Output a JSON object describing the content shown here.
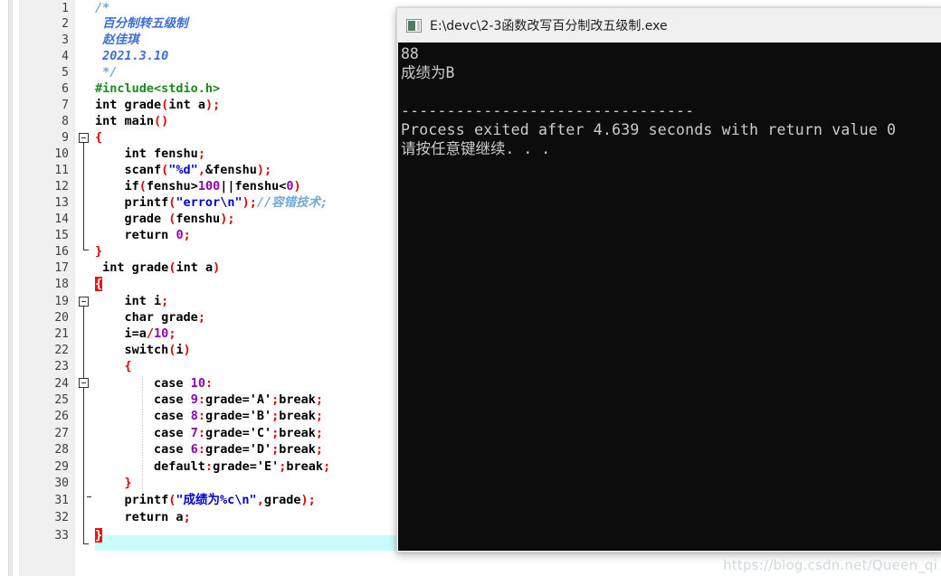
{
  "editor": {
    "name": "dev-cpp-editor",
    "gutter_bg": "#f0f0f0",
    "current_line": 33,
    "current_line_highlight": "#ccfbfb",
    "matching_brace_bg": "#ef1010",
    "line_numbers": [
      1,
      2,
      3,
      4,
      5,
      6,
      7,
      8,
      9,
      10,
      11,
      12,
      13,
      14,
      15,
      16,
      17,
      18,
      19,
      20,
      21,
      22,
      23,
      24,
      25,
      26,
      27,
      28,
      29,
      30,
      31,
      32,
      33
    ],
    "lines": [
      {
        "n": 1,
        "text": "/*"
      },
      {
        "n": 2,
        "text": " 百分制转五级制"
      },
      {
        "n": 3,
        "text": " 赵佳琪"
      },
      {
        "n": 4,
        "text": " 2021.3.10"
      },
      {
        "n": 5,
        "text": " */"
      },
      {
        "n": 6,
        "text": "#include<stdio.h>"
      },
      {
        "n": 7,
        "text": "int grade(int a);"
      },
      {
        "n": 8,
        "text": "int main()"
      },
      {
        "n": 9,
        "text": "{"
      },
      {
        "n": 10,
        "text": "    int fenshu;"
      },
      {
        "n": 11,
        "text": "    scanf(\"%d\",&fenshu);"
      },
      {
        "n": 12,
        "text": "    if(fenshu>100||fenshu<0)"
      },
      {
        "n": 13,
        "text": "    printf(\"error\\n\");//容错技术;"
      },
      {
        "n": 14,
        "text": "    grade (fenshu);"
      },
      {
        "n": 15,
        "text": "    return 0;"
      },
      {
        "n": 16,
        "text": "}"
      },
      {
        "n": 17,
        "text": " int grade(int a)"
      },
      {
        "n": 18,
        "text": "{"
      },
      {
        "n": 19,
        "text": "    int i;"
      },
      {
        "n": 20,
        "text": "    char grade;"
      },
      {
        "n": 21,
        "text": "    i=a/10;"
      },
      {
        "n": 22,
        "text": "    switch(i)"
      },
      {
        "n": 23,
        "text": "    {"
      },
      {
        "n": 24,
        "text": "        case 10:"
      },
      {
        "n": 25,
        "text": "        case 9:grade='A';break;"
      },
      {
        "n": 26,
        "text": "        case 8:grade='B';break;"
      },
      {
        "n": 27,
        "text": "        case 7:grade='C';break;"
      },
      {
        "n": 28,
        "text": "        case 6:grade='D';break;"
      },
      {
        "n": 29,
        "text": "        default:grade='E';break;"
      },
      {
        "n": 30,
        "text": "    }"
      },
      {
        "n": 31,
        "text": "    printf(\"成绩为%c\\n\",grade);"
      },
      {
        "n": 32,
        "text": "    return a;"
      },
      {
        "n": 33,
        "text": "}"
      }
    ],
    "fold_markers": [
      {
        "line": 9,
        "state": "expanded"
      },
      {
        "line": 18,
        "state": "expanded"
      },
      {
        "line": 23,
        "state": "expanded"
      }
    ],
    "syntax_colors": {
      "keyword": "#000000",
      "punctuation": "#e00000",
      "string": "#0000d0",
      "number": "#8f00b0",
      "preprocessor": "#1a8a1a",
      "comment": "#6fa8d6"
    }
  },
  "console": {
    "title": "E:\\devc\\2-3函数改写百分制改五级制.exe",
    "icon": "console-app-icon",
    "background": "#0c0c0c",
    "text_color": "#cccccc",
    "output_lines": [
      "88",
      "成绩为B",
      "",
      "--------------------------------",
      "Process exited after 4.639 seconds with return value 0",
      "请按任意键继续. . ."
    ],
    "exit_info": {
      "seconds": "4.639",
      "return_value": "0"
    }
  },
  "watermark": {
    "text": "https://blog.csdn.net/Queen_qi"
  }
}
